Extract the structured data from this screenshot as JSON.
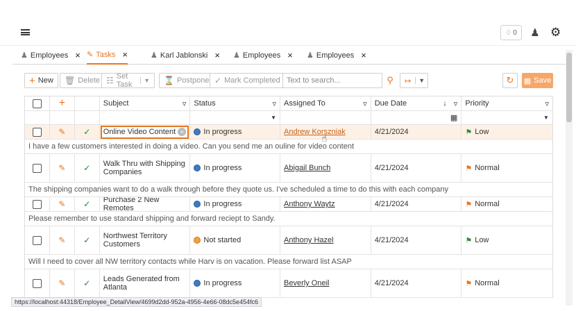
{
  "header": {
    "notif_count": "0",
    "bell_icon": "bell-icon",
    "user_icon": "user-icon",
    "gear_icon": "gear-icon"
  },
  "tabs": [
    {
      "label": "Employees",
      "icon": "employees-icon"
    },
    {
      "label": "Tasks",
      "icon": "tasks-icon",
      "active": true
    },
    {
      "label": "Karl Jablonski",
      "icon": "employee-icon"
    },
    {
      "label": "Employees",
      "icon": "employees-icon"
    },
    {
      "label": "Employees",
      "icon": "employees-icon"
    }
  ],
  "toolbar": {
    "new_label": "New",
    "delete_label": "Delete",
    "settask_label": "Set Task",
    "postpone_label": "Postpone",
    "markcompleted_label": "Mark Completed",
    "search_placeholder": "Text to search...",
    "save_label": "Save"
  },
  "columns": {
    "subject": "Subject",
    "status": "Status",
    "assigned": "Assigned To",
    "due": "Due Date",
    "priority": "Priority"
  },
  "rows": [
    {
      "subject": "Online Video Content",
      "status": "In progress",
      "status_type": "progress",
      "assigned": "Andrew Korszniak",
      "due": "4/21/2024",
      "priority": "Low",
      "priority_color": "#3d8b40",
      "description": "I have a few customers interested in doing a video. Can you send me an ouline for video content"
    },
    {
      "subject": "Walk Thru with Shipping Companies",
      "status": "In progress",
      "status_type": "progress",
      "assigned": "Abigail Bunch",
      "due": "4/21/2024",
      "priority": "Normal",
      "priority_color": "#e8761f",
      "description": "The shipping companies want to do a walk through before they quote us. I've scheduled a time to do this with each company"
    },
    {
      "subject": "Purchase 2 New Remotes",
      "status": "In progress",
      "status_type": "progress",
      "assigned": "Anthony Waytz",
      "due": "4/21/2024",
      "priority": "Normal",
      "priority_color": "#e8761f",
      "description": "Please remember to use standard shipping and forward reciept to Sandy."
    },
    {
      "subject": "Northwest Territory Customers",
      "status": "Not started",
      "status_type": "notstarted",
      "assigned": "Anthony Hazel",
      "due": "4/21/2024",
      "priority": "Low",
      "priority_color": "#3d8b40",
      "description": "Will I need to cover all NW territory contacts while Harv is on vacation. Please forward list ASAP"
    },
    {
      "subject": "Leads Generated from Atlanta",
      "status": "In progress",
      "status_type": "progress",
      "assigned": "Beverly Oneil",
      "due": "4/21/2024",
      "priority": "Normal",
      "priority_color": "#e8761f",
      "description": ""
    }
  ],
  "statusbar_url": "https://localhost:44318/Employee_DetailView/4699d2dd-952a-4956-4e66-08dc5e454fc6"
}
